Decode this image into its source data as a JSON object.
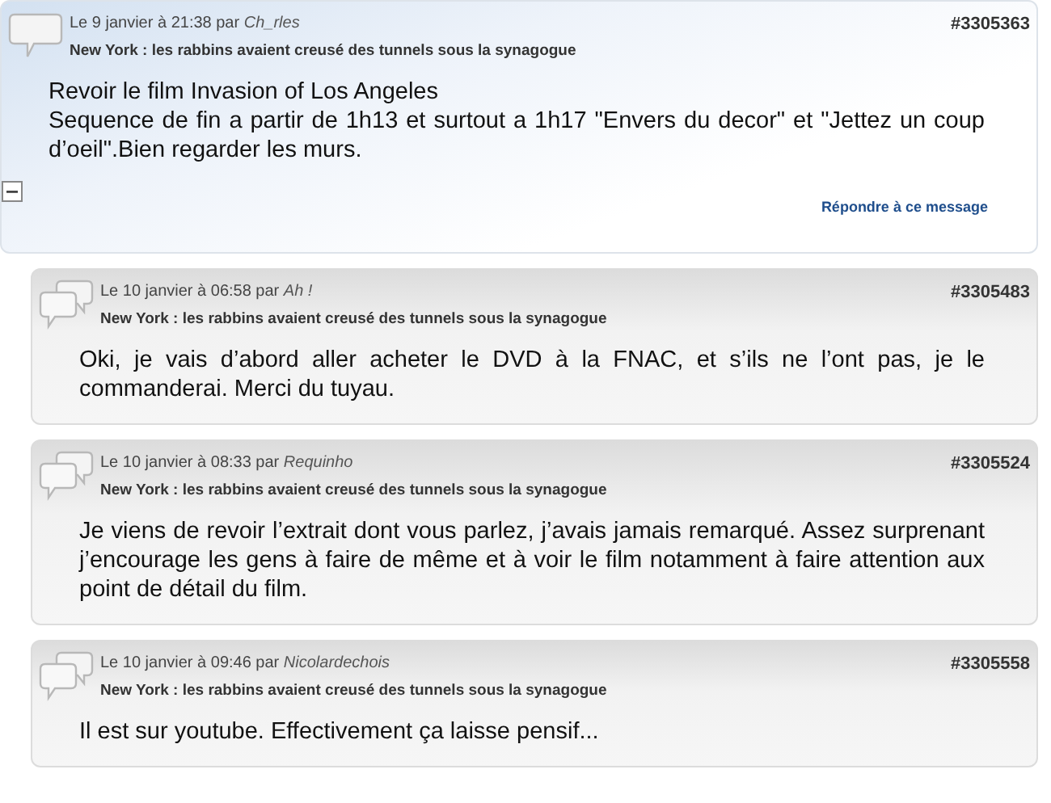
{
  "posts": [
    {
      "kind": "post",
      "meta": "Le 9 janvier à 21:38 par",
      "author": "Ch_rles",
      "number": "#3305363",
      "subject": "New York : les rabbins avaient creusé des tunnels sous la synagogue",
      "body": [
        "Revoir le film Invasion of Los Angeles",
        "Sequence de fin a partir de 1h13 et surtout a 1h17 \"Envers du decor\" et \"Jettez un coup d’oeil\".Bien regarder les murs."
      ],
      "collapsed": false,
      "reply_link": "Répondre à ce message"
    },
    {
      "kind": "reply",
      "meta": "Le 10 janvier à 06:58 par",
      "author": "Ah !",
      "number": "#3305483",
      "subject": "New York : les rabbins avaient creusé des tunnels sous la synagogue",
      "body": [
        "Oki, je vais d’abord aller acheter le DVD à la FNAC, et s’ils ne l’ont pas, je le commanderai. Merci du tuyau."
      ]
    },
    {
      "kind": "reply",
      "meta": "Le 10 janvier à 08:33 par",
      "author": "Requinho",
      "number": "#3305524",
      "subject": "New York : les rabbins avaient creusé des tunnels sous la synagogue",
      "body": [
        "Je viens de revoir l’extrait dont vous parlez, j’avais jamais remarqué. Assez surprenant j’encourage les gens à faire de même et à voir le film notamment à faire attention aux point de détail du film."
      ]
    },
    {
      "kind": "reply",
      "meta": "Le 10 janvier à 09:46 par",
      "author": "Nicolardechois",
      "number": "#3305558",
      "subject": "New York : les rabbins avaient creusé des tunnels sous la synagogue",
      "body": [
        "Il est sur youtube. Effectivement ça laisse pensif..."
      ]
    }
  ]
}
